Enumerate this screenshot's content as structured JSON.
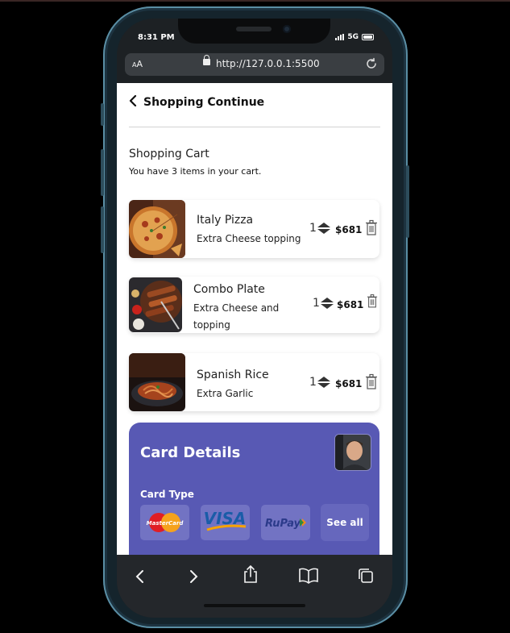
{
  "status_bar": {
    "time": "8:31 PM",
    "network": "5G"
  },
  "browser": {
    "text_size": "AA",
    "url": "http://127.0.0.1:5500"
  },
  "header": {
    "back_label": "Shopping Continue"
  },
  "cart": {
    "title": "Shopping Cart",
    "subtitle": "You have 3 items in your cart.",
    "items": [
      {
        "name": "Italy Pizza",
        "description": "Extra Cheese topping",
        "quantity": "1",
        "price": "$681"
      },
      {
        "name": "Combo Plate",
        "description": "Extra Cheese and topping",
        "quantity": "1",
        "price": "$681"
      },
      {
        "name": "Spanish Rice",
        "description": "Extra Garlic",
        "quantity": "1",
        "price": "$681"
      }
    ]
  },
  "card_details": {
    "title": "Card Details",
    "card_type_label": "Card Type",
    "card_types": [
      "MasterCard",
      "VISA",
      "RuPay"
    ],
    "see_all_label": "See all",
    "accent_color": "#5859b4"
  },
  "icons": [
    "back-chevron-icon",
    "lock-icon",
    "reload-icon",
    "quantity-stepper-icon",
    "trash-icon",
    "back-icon",
    "forward-icon",
    "share-icon",
    "bookmarks-icon",
    "tabs-icon"
  ]
}
